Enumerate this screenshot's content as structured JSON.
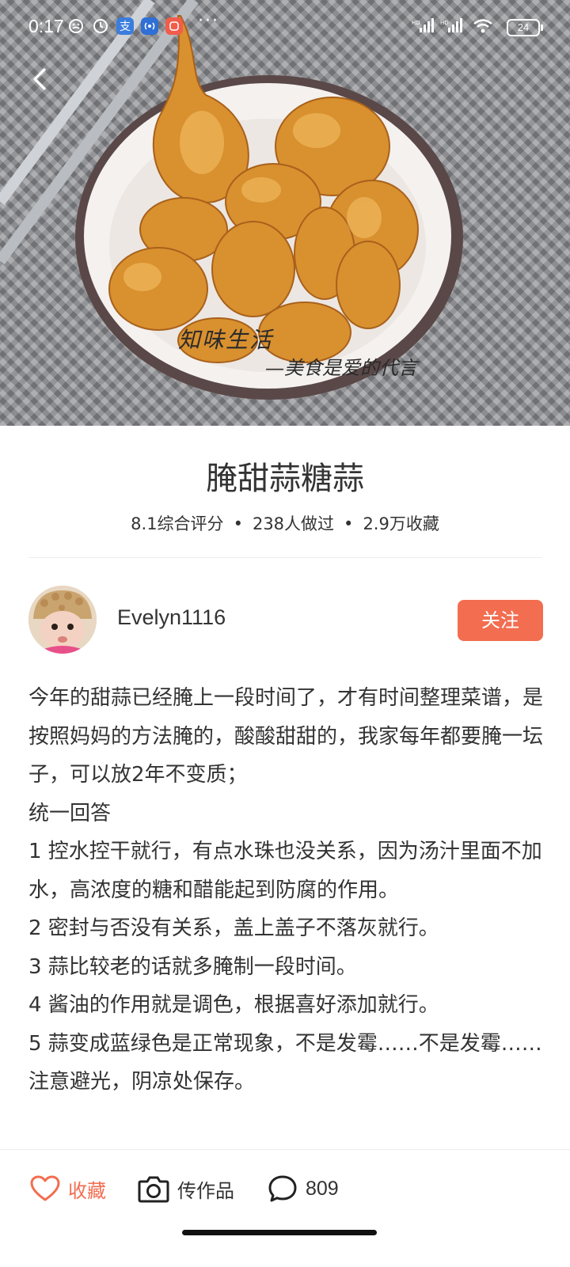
{
  "status_bar": {
    "time": "0:17",
    "battery": "24"
  },
  "hero": {
    "watermark_line1": "知味生活",
    "watermark_line2": "—美食是爱的代言"
  },
  "recipe": {
    "title": "腌甜蒜糖蒜",
    "rating": "8.1综合评分",
    "made_count": "238人做过",
    "favorites": "2.9万收藏",
    "meta_separator": "•"
  },
  "author": {
    "name": "Evelyn1116",
    "follow_label": "关注"
  },
  "description": [
    "今年的甜蒜已经腌上一段时间了，才有时间整理菜谱，是按照妈妈的方法腌的，酸酸甜甜的，我家每年都要腌一坛子，可以放2年不变质；",
    "统一回答",
    "1 控水控干就行，有点水珠也没关系，因为汤汁里面不加水，高浓度的糖和醋能起到防腐的作用。",
    "2 密封与否没有关系，盖上盖子不落灰就行。",
    "3 蒜比较老的话就多腌制一段时间。",
    "4 酱油的作用就是调色，根据喜好添加就行。",
    "5 蒜变成蓝绿色是正常现象，不是发霉……不是发霉……注意避光，阴凉处保存。"
  ],
  "bottom_bar": {
    "favorite_label": "收藏",
    "upload_label": "传作品",
    "comment_count": "809"
  },
  "colors": {
    "accent": "#f36d50",
    "text": "#333333"
  }
}
